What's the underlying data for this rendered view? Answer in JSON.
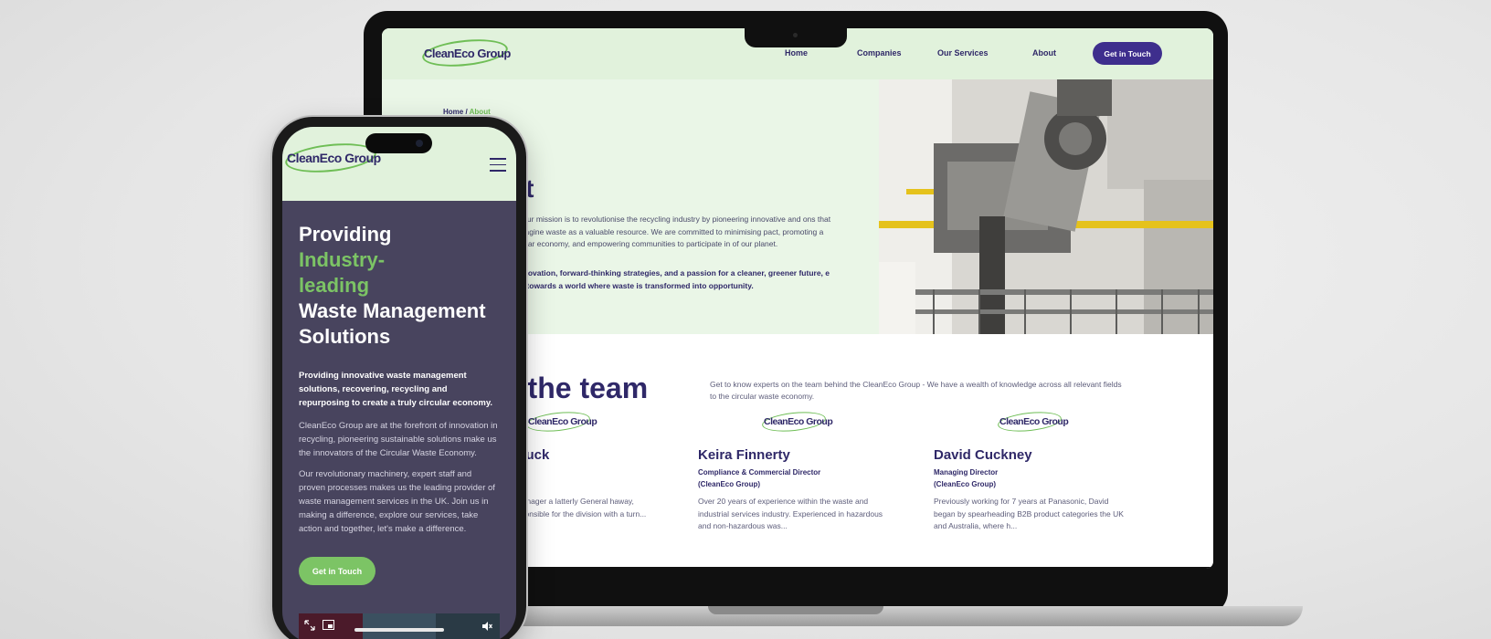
{
  "laptop": {
    "logo": "CleanEco Group",
    "nav": [
      "Home",
      "Companies",
      "Our Services",
      "About"
    ],
    "cta": "Get in Touch",
    "breadcrumb": {
      "home": "Home",
      "sep": "/",
      "current": "About"
    },
    "about_title": "ut",
    "about_p1": "up, our mission is to revolutionise the recycling industry by pioneering innovative and ons that reimagine waste as a valuable resource. We are committed to minimising pact, promoting a circular economy, and empowering communities to participate in of our planet.",
    "about_p2": "s innovation, forward-thinking strategies, and a passion for a cleaner, greener future, e way towards a world where waste is transformed into opportunity.",
    "team_title": "t the team",
    "team_intro": "Get to know experts on the team behind the CleanEco Group - We have a wealth of knowledge across all relevant fields to the circular waste economy.",
    "team": [
      {
        "logo": "CleanEco Group",
        "name": "ebuck",
        "role1": "",
        "role2": "",
        "desc": "s Manager a latterly General haway, responsible for the division with a turn..."
      },
      {
        "logo": "CleanEco Group",
        "name": "Keira Finnerty",
        "role1": "Compliance & Commercial Director",
        "role2": "(CleanEco Group)",
        "desc": "Over 20 years of experience within the waste and industrial services industry. Experienced in hazardous and non-hazardous was..."
      },
      {
        "logo": "CleanEco Group",
        "name": "David Cuckney",
        "role1": "Managing Director",
        "role2": "(CleanEco Group)",
        "desc": "Previously working for 7 years at Panasonic, David began by spearheading B2B product categories the UK and Australia, where h..."
      }
    ]
  },
  "phone": {
    "logo": "CleanEco Group",
    "title_line1": "Providing",
    "title_hl1": "Industry-",
    "title_hl2": "leading",
    "title_line3": "Waste Management",
    "title_line4": "Solutions",
    "lead": "Providing innovative waste management solutions, recovering, recycling and repurposing to create a truly circular economy.",
    "body1": "CleanEco Group are at the forefront of innovation in recycling, pioneering sustainable solutions make us the innovators of the Circular Waste Economy.",
    "body2": "Our revolutionary machinery, expert staff and proven processes makes us the leading provider of waste management services in the UK. Join us in making a difference, explore our services, take action and together, let's make a difference.",
    "cta": "Get in Touch"
  },
  "colors": {
    "brand_purple": "#2f2868",
    "brand_green": "#6fbe56",
    "header_bg": "#e1f2dc",
    "phone_bg": "#48445e",
    "cta_purple": "#3e2e8d"
  },
  "icons": [
    "hamburger-menu-icon",
    "expand-icon",
    "pip-icon",
    "mute-icon"
  ]
}
